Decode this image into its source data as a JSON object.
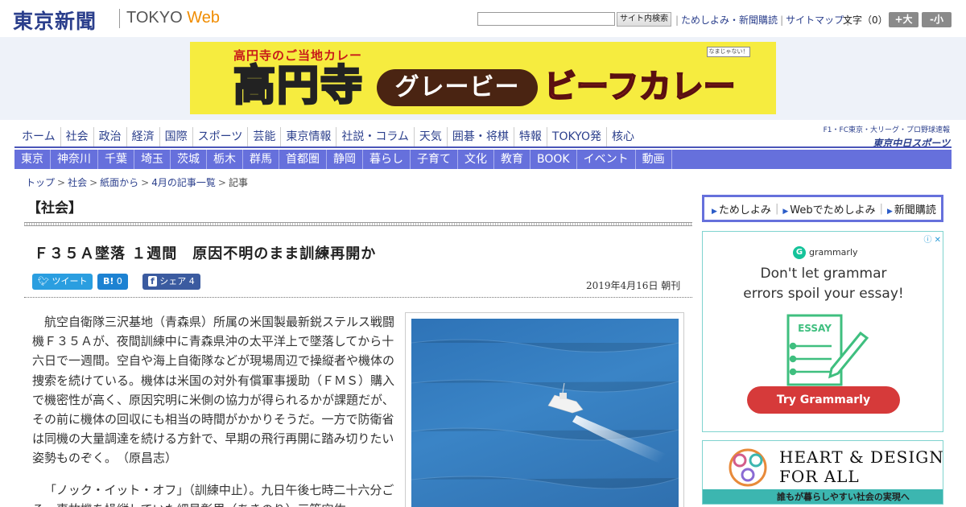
{
  "header": {
    "logo_ja": "東京新聞",
    "logo_en_prefix": "TOKYO",
    "logo_en_suffix": "Web",
    "search_button": "サイト内検索",
    "links": [
      "ためしよみ・新聞購読",
      "サイトマップ"
    ],
    "font_size_label": "文字（0）",
    "font_up": "+大",
    "font_down": "-小"
  },
  "banner": {
    "top_text": "高円寺のご当地カレー",
    "kanji": "高円寺",
    "pill": "グレービー",
    "katakana": "ビーフカレー",
    "mini_badge": "なまじゃない！"
  },
  "nav_primary": [
    "ホーム",
    "社会",
    "政治",
    "経済",
    "国際",
    "スポーツ",
    "芸能",
    "東京情報",
    "社説・コラム",
    "天気",
    "囲碁・将棋",
    "特報",
    "TOKYO発",
    "核心"
  ],
  "chunichi": {
    "line1": "F1・FC東京・大リーグ・プロ野球速報",
    "line2": "東京中日スポーツ"
  },
  "nav_secondary": [
    "東京",
    "神奈川",
    "千葉",
    "埼玉",
    "茨城",
    "栃木",
    "群馬",
    "首都圏",
    "静岡",
    "暮らし",
    "子育て",
    "文化",
    "教育",
    "BOOK",
    "イベント",
    "動画"
  ],
  "breadcrumb": [
    "トップ",
    "社会",
    "紙面から",
    "4月の記事一覧",
    "記事"
  ],
  "article": {
    "category": "【社会】",
    "headline": "Ｆ３５Ａ墜落 １週間　原因不明のまま訓練再開か",
    "share": {
      "tweet": "ツイート",
      "hatena_label": "B!",
      "hatena_count": "0",
      "facebook_label": "シェア",
      "facebook_count": "4"
    },
    "date": "2019年4月16日 朝刊",
    "paragraph1": "航空自衛隊三沢基地（青森県）所属の米国製最新鋭ステルス戦闘機Ｆ３５Ａが、夜間訓練中に青森県沖の太平洋上で墜落してから十六日で一週間。空自や海上自衛隊などが現場周辺で操縦者や機体の捜索を続けている。機体は米国の対外有償軍事援助（ＦＭＳ）購入で機密性が高く、原因究明に米側の協力が得られるかが課題だが、その前に機体の回収にも相当の時間がかかりそうだ。一方で防衛省は同機の大量調達を続ける方針で、早期の飛行再開に踏み切りたい姿勢ものぞく。　（原昌志）",
    "paragraph2": "「ノック・イット・オフ」（訓練中止）。九日午後七時二十六分ごろ、事故機を操縦していた細見彰里（あきのり）三等空佐"
  },
  "sidebar": {
    "subscribe": [
      "ためしよみ",
      "Webでためしよみ",
      "新聞購読"
    ],
    "ad1": {
      "brand": "grammarly",
      "text_line1": "Don't let grammar",
      "text_line2": "errors spoil your essay!",
      "doc_label": "ESSAY",
      "button": "Try Grammarly"
    },
    "ad2": {
      "line1": "HEART & DESIGN",
      "line2": "FOR ALL",
      "sub": "誰もが暮らしやすい社会の実現へ"
    }
  }
}
